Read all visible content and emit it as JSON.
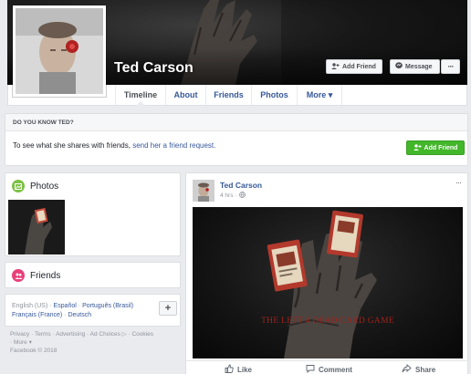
{
  "profile": {
    "name": "Ted Carson",
    "add_friend_label": "Add Friend",
    "message_label": "Message",
    "more_dots": "···"
  },
  "nav": {
    "tabs": [
      {
        "label": "Timeline"
      },
      {
        "label": "About"
      },
      {
        "label": "Friends"
      },
      {
        "label": "Photos"
      },
      {
        "label": "More ▾"
      }
    ]
  },
  "know": {
    "heading": "DO YOU KNOW TED?",
    "text": "To see what she shares with friends, ",
    "link": "send her a friend request.",
    "button": "Add Friend"
  },
  "sidebar": {
    "photos_label": "Photos",
    "friends_label": "Friends",
    "lang_current": "English (US)",
    "languages": [
      "Español",
      "Português (Brasil)",
      "Français (France)",
      "Deutsch"
    ],
    "plus": "+",
    "footer_line1": "Privacy · Terms · Advertising · Ad Choices ▷ · Cookies",
    "footer_line2": "· More ▾",
    "footer_line3": "Facebook © 2018"
  },
  "post": {
    "author": "Ted Carson",
    "time": "4 hrs ·",
    "dots": "···",
    "image_caption": "THE LEFT 4 DEAD CARD GAME",
    "like": "Like",
    "comment": "Comment",
    "share": "Share"
  },
  "colors": {
    "link": "#365899",
    "green": "#42b72a",
    "caption_red": "#a0211b"
  }
}
